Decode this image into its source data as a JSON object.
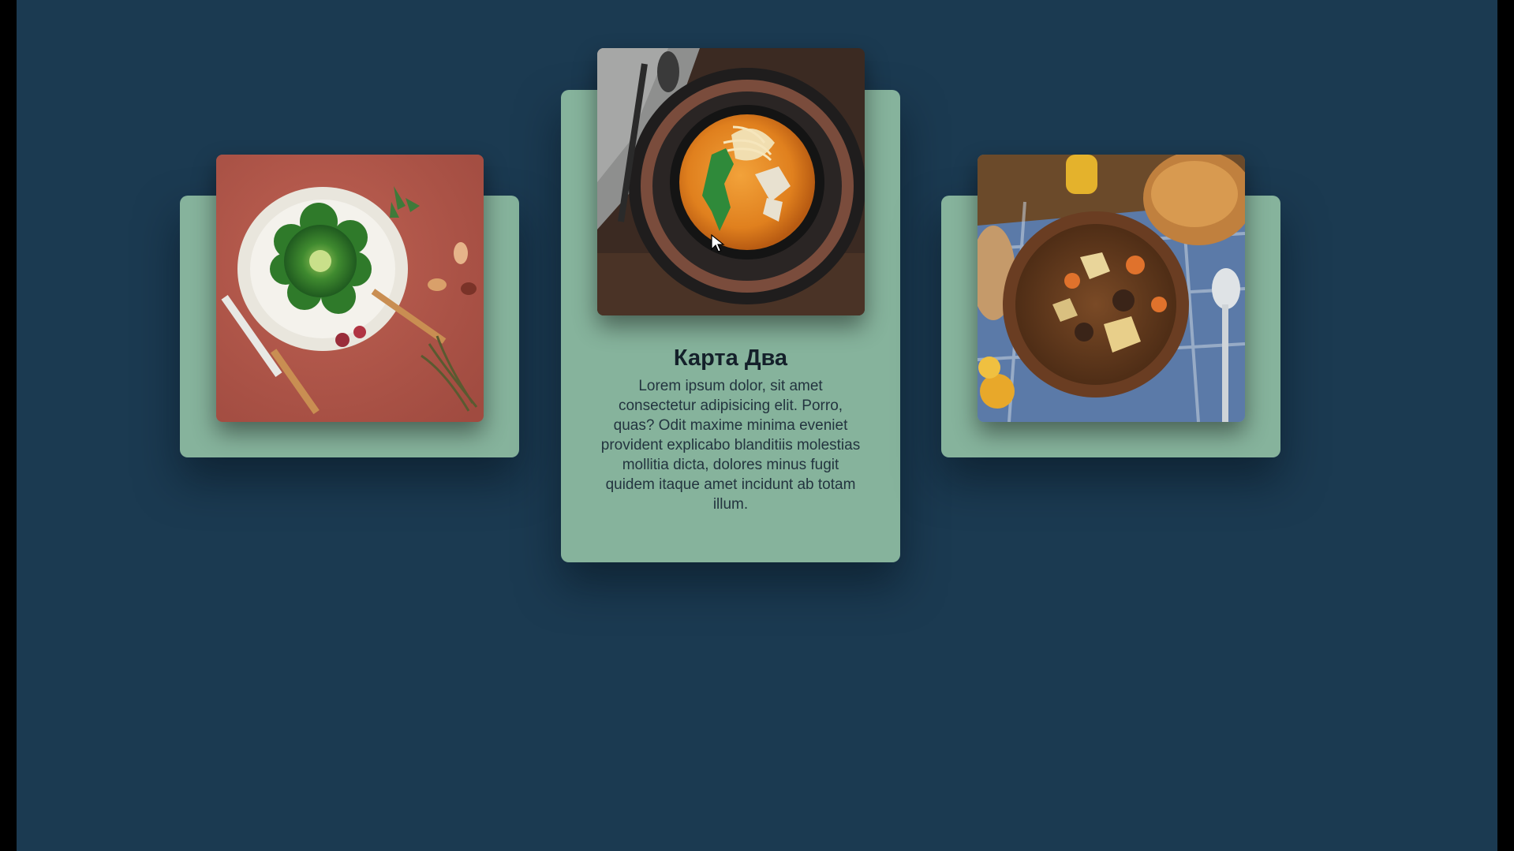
{
  "cards": [
    {
      "id": "left",
      "image_alt": "broccoli-plate-icon",
      "accent_color": "#b3574a"
    },
    {
      "id": "center",
      "image_alt": "noodle-soup-bowl-icon",
      "title": "Карта Два",
      "text": "Lorem ipsum dolor, sit amet consectetur adipisicing elit. Porro, quas? Odit maxime minima eveniet provident explicabo blanditiis molestias mollitia dicta, dolores minus fugit quidem itaque amet incidunt ab totam illum.",
      "accent_color": "#e28a24"
    },
    {
      "id": "right",
      "image_alt": "stew-bowl-icon",
      "accent_color": "#6a4326"
    }
  ],
  "colors": {
    "background": "#1b3a51",
    "card": "#86b39c",
    "frame": "#000000"
  }
}
